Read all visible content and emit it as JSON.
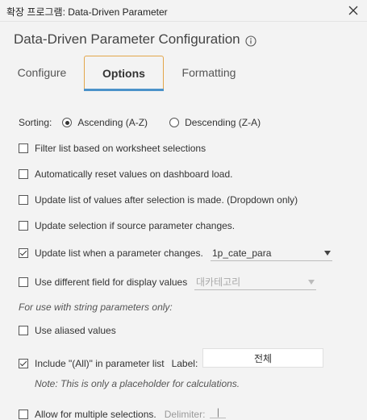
{
  "window": {
    "title": "확장 프로그램: Data-Driven Parameter",
    "close_icon": "close-icon"
  },
  "header": {
    "title": "Data-Driven Parameter Configuration",
    "info_icon": "info-icon"
  },
  "tabs": [
    {
      "label": "Configure",
      "active": false
    },
    {
      "label": "Options",
      "active": true
    },
    {
      "label": "Formatting",
      "active": false
    }
  ],
  "sorting": {
    "label": "Sorting:",
    "options": [
      "Ascending (A-Z)",
      "Descending (Z-A)"
    ],
    "selected": "Ascending (A-Z)"
  },
  "options": {
    "filter_list": {
      "label": "Filter list based on worksheet selections",
      "checked": false
    },
    "auto_reset": {
      "label": "Automatically reset values on dashboard load.",
      "checked": false
    },
    "update_after_selection": {
      "label": "Update list of values after selection is made. (Dropdown only)",
      "checked": false
    },
    "update_on_source_change": {
      "label": "Update selection if source parameter changes.",
      "checked": false
    },
    "update_on_param_change": {
      "label": "Update list when a parameter changes.",
      "checked": true,
      "parameter_value": "1p_cate_para"
    },
    "display_field": {
      "label": "Use different field for display values",
      "checked": false,
      "field_value": "대카테고리"
    },
    "string_note": "For use with string parameters only:",
    "aliased_values": {
      "label": "Use aliased values",
      "checked": false
    },
    "include_all": {
      "label": "Include \"(All)\" in parameter list",
      "checked": true,
      "label_caption": "Label:",
      "label_value": "전체"
    },
    "placeholder_note": "Note: This is only a placeholder for calculations.",
    "multiple_selections": {
      "label": "Allow for multiple selections.",
      "checked": false,
      "delimiter_label": "Delimiter:",
      "delimiter_value": "|"
    }
  }
}
